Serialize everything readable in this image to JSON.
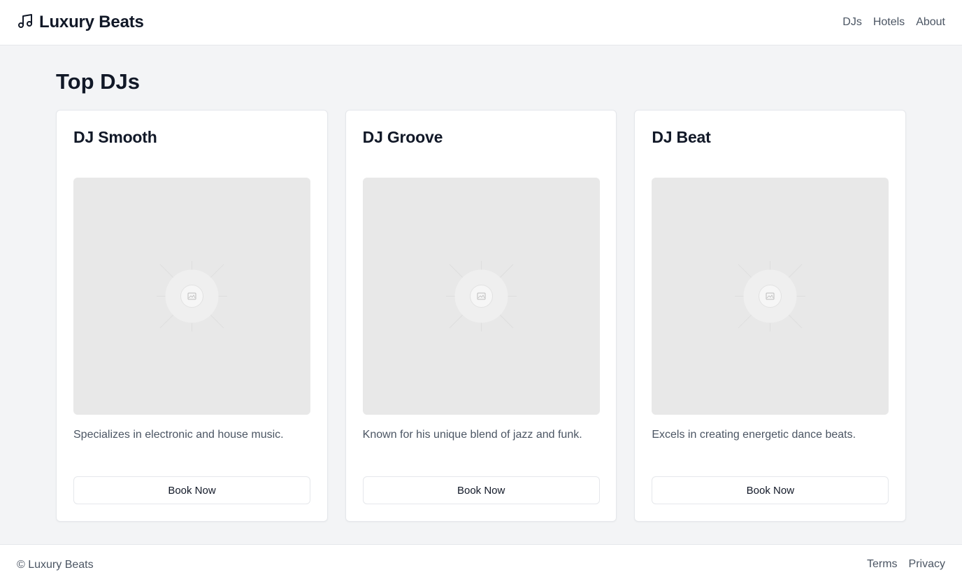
{
  "brand": {
    "name": "Luxury Beats",
    "icon": "music-note-icon"
  },
  "nav": {
    "items": [
      "DJs",
      "Hotels",
      "About"
    ]
  },
  "page": {
    "title": "Top DJs"
  },
  "cards": [
    {
      "name": "DJ Smooth",
      "description": "Specializes in electronic and house music.",
      "button": "Book Now",
      "image_icon": "image-placeholder-icon"
    },
    {
      "name": "DJ Groove",
      "description": "Known for his unique blend of jazz and funk.",
      "button": "Book Now",
      "image_icon": "image-placeholder-icon"
    },
    {
      "name": "DJ Beat",
      "description": "Excels in creating energetic dance beats.",
      "button": "Book Now",
      "image_icon": "image-placeholder-icon"
    }
  ],
  "footer": {
    "copyright": "© Luxury Beats",
    "links": [
      "Terms",
      "Privacy"
    ]
  },
  "colors": {
    "background": "#f3f4f6",
    "surface": "#ffffff",
    "border": "#e5e7eb",
    "text": "#111827",
    "muted": "#4b5563",
    "placeholder": "#e8e8e8"
  }
}
